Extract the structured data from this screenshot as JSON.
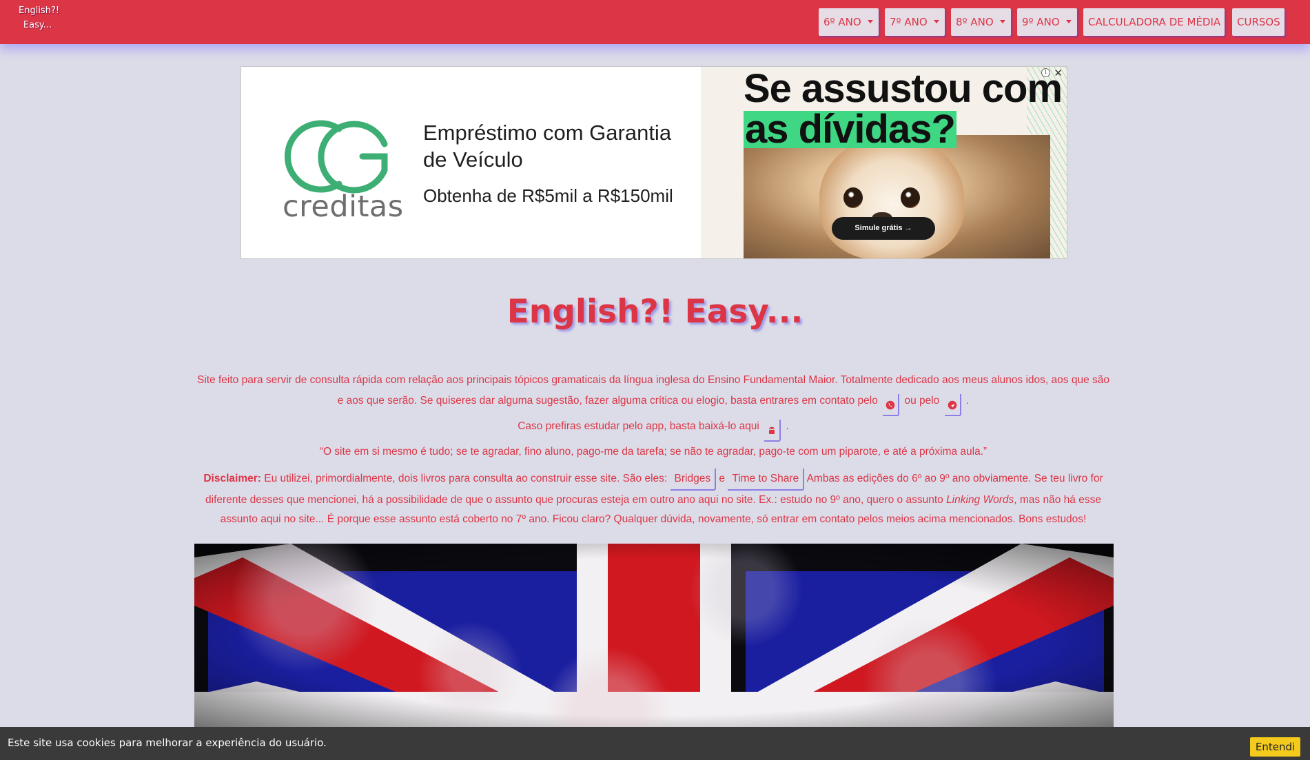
{
  "navbar": {
    "brand_line1": "English?!",
    "brand_line2": "Easy...",
    "menu": [
      {
        "label": "6º ANO"
      },
      {
        "label": "7º ANO"
      },
      {
        "label": "8º ANO"
      },
      {
        "label": "9º ANO"
      },
      {
        "label": "CALCULADORA DE MÉDIA"
      },
      {
        "label": "CURSOS"
      }
    ],
    "colors": {
      "background": "#dc3545",
      "button_bg": "#e6dce6",
      "button_text": "#dc3545"
    }
  },
  "ad": {
    "brand": "creditas",
    "headline": "Empréstimo com Garantia de Veículo",
    "subline": "Obtenha de R$5mil a R$150mil",
    "big_line1": "Se assustou com",
    "big_line2": "as dívidas?",
    "cta": "Simule grátis",
    "info_icon": "info-icon",
    "close_icon": "close-icon",
    "colors": {
      "logo_green": "#3dae74",
      "highlight_green": "#3fd684"
    }
  },
  "main": {
    "title": "English?! Easy...",
    "intro_1a": "Site feito para servir de consulta rápida com relação aos principais tópicos gramaticais da língua inglesa do Ensino Fundamental Maior. Totalmente dedicado aos meus alunos idos, aos que são e aos que serão. Se quiseres dar alguma sugestão, fazer alguma crítica ou elogio, basta entrares em contato pelo",
    "intro_1b": "ou pelo",
    "intro_1c": ".",
    "intro_2a": "Caso prefiras estudar pelo app, basta baixá-lo aqui",
    "intro_2b": ".",
    "quote": "“O site em si mesmo é tudo; se te agradar, fino aluno, pago-me da tarefa; se não te agradar, pago-te com um piparote, e até a próxima aula.”",
    "disclaimer_label": "Disclaimer:",
    "disclaimer_a": "Eu utilizei, primordialmente, dois livros para consulta ao construir esse site. São eles:",
    "book_1": "Bridges",
    "disclaimer_and": "e",
    "book_2": "Time to Share",
    "disclaimer_b": "Ambas as edições do 6º ao 9º ano obviamente. Se teu livro for diferente desses que mencionei, há a possibilidade de que o assunto que procuras esteja em outro ano aqui no site. Ex.: estudo no 9º ano, quero o assunto",
    "disclaimer_em": "Linking Words",
    "disclaimer_c": ", mas não há esse assunto aqui no site... É porque esse assunto está coberto no 7º ano. Ficou claro? Qualquer dúvida, novamente, só entrar em contato pelos meios acima mencionados. Bons estudos!",
    "icons": [
      "whatsapp-icon",
      "email-icon",
      "android-icon"
    ],
    "text_color": "#dc3545"
  },
  "cookie": {
    "text": "Este site usa cookies para melhorar a experiência do usuário.",
    "button": "Entendi"
  }
}
